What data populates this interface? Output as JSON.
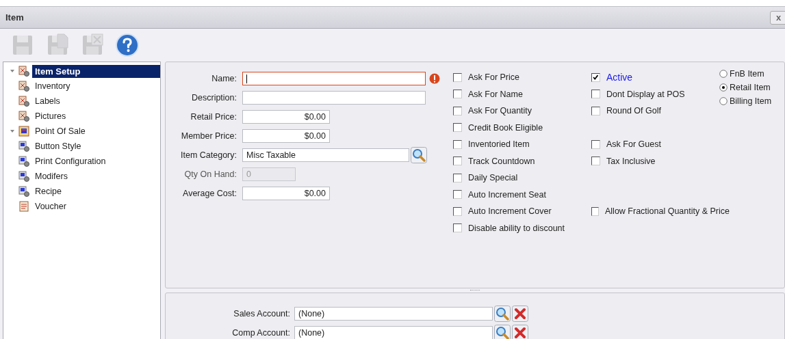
{
  "window": {
    "title": "Item",
    "close": "x"
  },
  "toolbar": [
    {
      "kind": "save",
      "disabled": true
    },
    {
      "kind": "save-new",
      "disabled": true
    },
    {
      "kind": "delete",
      "disabled": true
    },
    {
      "kind": "help",
      "disabled": false
    }
  ],
  "tree": [
    {
      "label": "Item Setup",
      "kind": "setup",
      "expanded": true,
      "selected": true,
      "children": [
        {
          "label": "Inventory",
          "kind": "setup",
          "selected": false
        },
        {
          "label": "Labels",
          "kind": "setup",
          "selected": false
        },
        {
          "label": "Pictures",
          "kind": "setup",
          "selected": false
        }
      ]
    },
    {
      "label": "Point Of Sale",
      "kind": "register",
      "expanded": true,
      "selected": false,
      "children": [
        {
          "label": "Button Style",
          "kind": "register-setup",
          "selected": false
        },
        {
          "label": "Print Configuration",
          "kind": "register-setup",
          "selected": false
        },
        {
          "label": "Modifers",
          "kind": "register-setup",
          "selected": false
        },
        {
          "label": "Recipe",
          "kind": "register-setup",
          "selected": false
        },
        {
          "label": "Voucher",
          "kind": "voucher",
          "selected": false
        }
      ]
    }
  ],
  "fields": [
    {
      "label": "Name:",
      "kind": "text",
      "error": true,
      "disabled": false
    },
    {
      "label": "Description:",
      "kind": "text",
      "error": false,
      "disabled": false
    },
    {
      "label": "Retail Price:",
      "value": "$0.00",
      "kind": "money",
      "error": false,
      "disabled": false
    },
    {
      "label": "Member Price:",
      "value": "$0.00",
      "kind": "money",
      "error": false,
      "disabled": false
    },
    {
      "label": "Item Category:",
      "value": "Misc Taxable",
      "kind": "lookup",
      "error": false,
      "disabled": false
    },
    {
      "label": "Qty On Hand:",
      "value": "0",
      "kind": "count",
      "error": false,
      "disabled": true
    },
    {
      "label": "Average Cost:",
      "value": "$0.00",
      "kind": "money",
      "error": false,
      "disabled": false
    }
  ],
  "checkbox_rows": [
    [
      {
        "label": "Ask For Price",
        "checked": false
      },
      {
        "label": "Active",
        "checked": true
      }
    ],
    [
      {
        "label": "Ask For Name",
        "checked": false
      },
      {
        "label": "Dont Display at POS",
        "checked": false
      }
    ],
    [
      {
        "label": "Ask For Quantity",
        "checked": false
      },
      {
        "label": "Round Of Golf",
        "checked": false
      }
    ],
    [
      {
        "label": "Credit Book Eligible",
        "checked": false
      }
    ],
    [
      {
        "label": "Inventoried Item",
        "checked": false
      },
      {
        "label": "Ask For Guest",
        "checked": false
      }
    ],
    [
      {
        "label": "Track Countdown",
        "checked": false
      },
      {
        "label": "Tax Inclusive",
        "checked": false
      }
    ],
    [
      {
        "label": "Daily Special",
        "checked": false
      }
    ],
    [
      {
        "label": "Auto Increment Seat",
        "checked": false
      }
    ],
    [
      {
        "label": "Auto Increment Cover",
        "checked": false
      },
      {
        "label": "Allow Fractional Quantity & Price",
        "checked": false
      }
    ],
    [
      {
        "label": "Disable ability to discount",
        "checked": false
      }
    ]
  ],
  "item_types": [
    {
      "label": "FnB Item",
      "selected": false
    },
    {
      "label": "Retail Item",
      "selected": true
    },
    {
      "label": "Billing Item",
      "selected": false
    }
  ],
  "accounts": [
    {
      "label": "Sales Account:",
      "value": "(None)"
    },
    {
      "label": "Comp Account:",
      "value": "(None)"
    }
  ]
}
